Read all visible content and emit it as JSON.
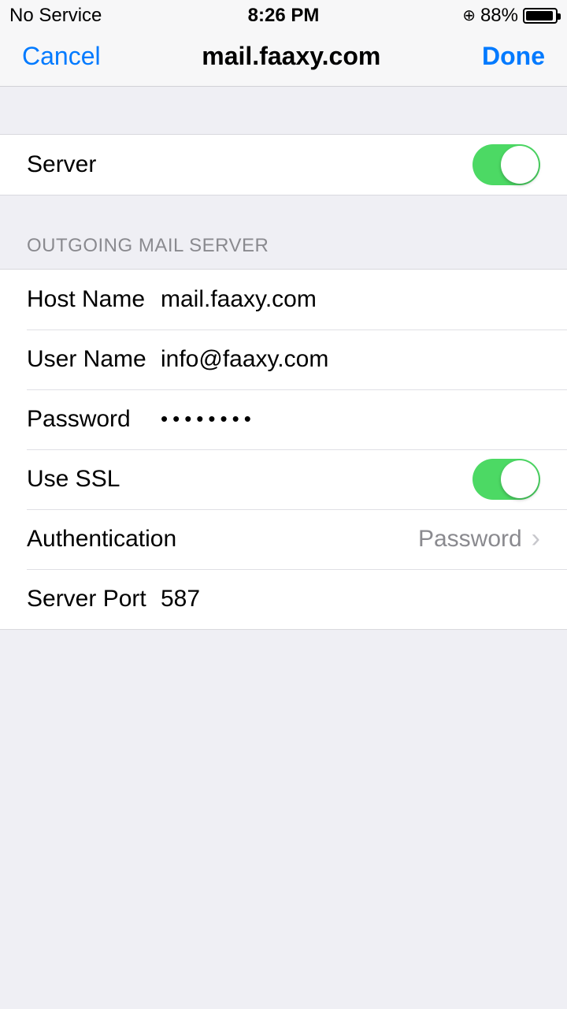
{
  "status": {
    "carrier": "No Service",
    "time": "8:26 PM",
    "battery_pct": "88%"
  },
  "nav": {
    "cancel": "Cancel",
    "title": "mail.faaxy.com",
    "done": "Done"
  },
  "server_section": {
    "label": "Server",
    "enabled": true
  },
  "outgoing": {
    "header": "OUTGOING MAIL SERVER",
    "host_label": "Host Name",
    "host_value": "mail.faaxy.com",
    "user_label": "User Name",
    "user_value": "info@faaxy.com",
    "password_label": "Password",
    "password_mask": "••••••••",
    "ssl_label": "Use SSL",
    "ssl_enabled": true,
    "auth_label": "Authentication",
    "auth_value": "Password",
    "port_label": "Server Port",
    "port_value": "587"
  }
}
